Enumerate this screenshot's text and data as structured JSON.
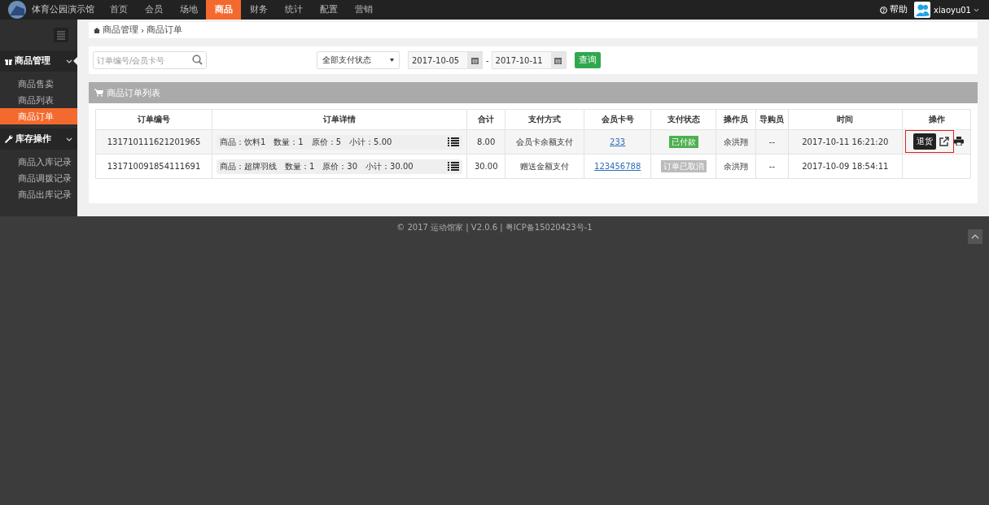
{
  "brand": {
    "name": "体育公园演示馆"
  },
  "nav": [
    {
      "label": "首页",
      "selected": false
    },
    {
      "label": "会员",
      "selected": false
    },
    {
      "label": "场地",
      "selected": false
    },
    {
      "label": "商品",
      "selected": true
    },
    {
      "label": "财务",
      "selected": false
    },
    {
      "label": "统计",
      "selected": false
    },
    {
      "label": "配置",
      "selected": false
    },
    {
      "label": "营销",
      "selected": false
    }
  ],
  "help": "帮助",
  "user": "xiaoyu01",
  "sidebar": [
    {
      "label": "商品管理",
      "expanded": true,
      "children": [
        {
          "label": "商品售卖",
          "selected": false
        },
        {
          "label": "商品列表",
          "selected": false
        },
        {
          "label": "商品订单",
          "selected": true
        }
      ]
    },
    {
      "label": "库存操作",
      "expanded": true,
      "children": [
        {
          "label": "商品入库记录",
          "selected": false
        },
        {
          "label": "商品调拨记录",
          "selected": false
        },
        {
          "label": "商品出库记录",
          "selected": false
        }
      ]
    }
  ],
  "breadcrumb": [
    "商品管理",
    "商品订单"
  ],
  "breadcrumb_separator": "›",
  "filters": {
    "search_placeholder": "订单编号/会员卡号",
    "status_select": "全部支付状态",
    "date_from": "2017-10-05",
    "date_sep": "-",
    "date_to": "2017-10-11",
    "query_button": "查询"
  },
  "panel_title": "商品订单列表",
  "table": {
    "columns": [
      "订单编号",
      "订单详情",
      "合计",
      "支付方式",
      "会员卡号",
      "支付状态",
      "操作员",
      "导购员",
      "时间",
      "操作"
    ],
    "rows": [
      {
        "order_no": "131710111621201965",
        "detail": "商品：饮料1　数量：1　原价：5　小计：5.00",
        "total": "8.00",
        "payment": "会员卡余额支付",
        "card": "233",
        "status": "已付款",
        "paid": true,
        "operator": "余洪翔",
        "guide": "--",
        "time": "2017-10-11 16:21:20",
        "actions": true
      },
      {
        "order_no": "131710091854111691",
        "detail": "商品：超牌羽线　数量：1　原价：30　小计：30.00",
        "total": "30.00",
        "payment": "赠送金额支付",
        "card": "123456788",
        "status": "订单已取消",
        "paid": false,
        "operator": "余洪翔",
        "guide": "--",
        "time": "2017-10-09 18:54:11",
        "actions": false
      }
    ]
  },
  "tooltip": "退货",
  "footer": "© 2017 运动馆家 | V2.0.6 | 粤ICP备15020423号-1"
}
